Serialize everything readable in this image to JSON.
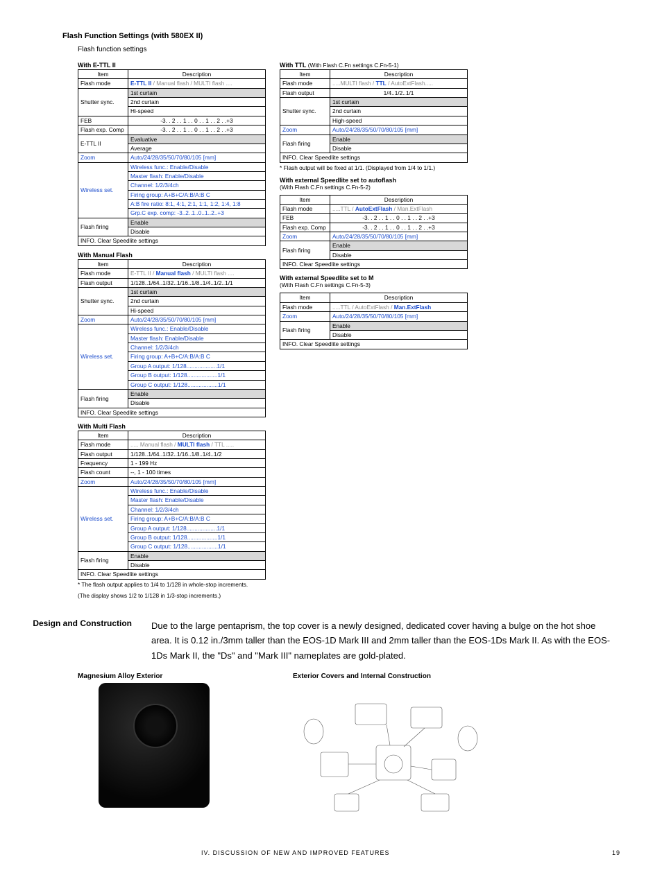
{
  "header": {
    "section_title": "Flash Function Settings (with 580EX II)",
    "subtitle": "Flash function settings"
  },
  "th_item": "Item",
  "th_desc": "Description",
  "info_clear": "INFO.    Clear Speedlite settings",
  "left": {
    "t1": {
      "caption": "With E-TTL II",
      "rows": [
        {
          "k": "Flash mode",
          "v": "E-TTL II / Manual flash / MULTI flash ....",
          "blue": true,
          "bold": "E-TTL II"
        },
        {
          "k": "Shutter sync.",
          "v1": "1st curtain",
          "v2": "2nd curtain",
          "v3": "Hi-speed",
          "grey": 1
        },
        {
          "k": "FEB",
          "v": "-3. . 2 . . 1 . . 0 . . 1 . . 2 . .+3",
          "center": true
        },
        {
          "k": "Flash exp. Comp",
          "v": "-3. . 2 . . 1 . . 0 . . 1 . . 2 . .+3",
          "center": true
        },
        {
          "k": "E-TTL II",
          "v1": "Evaluative",
          "v2": "Average",
          "grey": 1
        },
        {
          "k": "Zoom",
          "v": "Auto/24/28/35/50/70/80/105 [mm]",
          "blue": true,
          "kblue": true
        },
        {
          "k": "Wireless set.",
          "kblue": true,
          "list": [
            "Wireless func.: Enable/Disable",
            "Master flash: Enable/Disable",
            "Channel: 1/2/3/4ch",
            "Firing group: A+B+C/A:B/A:B C",
            "A:B fire ratio: 8:1, 4:1, 2:1, 1:1, 1:2, 1:4, 1:8",
            "Grp.C exp. comp: -3..2..1..0..1..2..+3"
          ]
        },
        {
          "k": "Flash firing",
          "v1": "Enable",
          "v2": "Disable",
          "grey": 1
        }
      ]
    },
    "t2": {
      "caption": "With Manual Flash",
      "rows": [
        {
          "k": "Flash mode",
          "v": "E-TTL II / Manual flash     / MULTI flash ....",
          "blue": true,
          "bold": "Manual flash"
        },
        {
          "k": "Flash output",
          "v": "1/128..1/64..1/32..1/16..1/8..1/4..1/2..1/1"
        },
        {
          "k": "Shutter sync.",
          "v1": "1st curtain",
          "v2": "2nd curtain",
          "v3": "Hi-speed",
          "grey": 1
        },
        {
          "k": "Zoom",
          "v": "Auto/24/28/35/50/70/80/105 [mm]",
          "blue": true,
          "kblue": true
        },
        {
          "k": "Wireless set.",
          "kblue": true,
          "list": [
            "Wireless func.: Enable/Disable",
            "Master flash: Enable/Disable",
            "Channel: 1/2/3/4ch",
            "Firing group: A+B+C/A:B/A:B C",
            "Group A output: 1/128...................1/1",
            "Group B output: 1/128...................1/1",
            "Group C output: 1/128...................1/1"
          ]
        },
        {
          "k": "Flash firing",
          "v1": "Enable",
          "v2": "Disable",
          "grey": 1
        }
      ]
    },
    "t3": {
      "caption": "With Multi Flash",
      "rows": [
        {
          "k": "Flash mode",
          "v": "..... Manual flash / MULTI flash      / TTL .....",
          "blue": true,
          "bold": "MULTI flash"
        },
        {
          "k": "Flash output",
          "v": "1/128..1/64..1/32..1/16..1/8..1/4..1/2"
        },
        {
          "k": "Frequency",
          "v": "1 - 199 Hz"
        },
        {
          "k": "Flash count",
          "v": "--, 1 - 100 times"
        },
        {
          "k": "Zoom",
          "v": "Auto/24/28/35/50/70/80/105 [mm]",
          "blue": true,
          "kblue": true
        },
        {
          "k": "Wireless set.",
          "kblue": true,
          "list": [
            "Wireless func.: Enable/Disable",
            "Master flash: Enable/Disable",
            "Channel: 1/2/3/4ch",
            "Firing group: A+B+C/A:B/A:B C",
            "Group A output: 1/128...................1/1",
            "Group B output: 1/128...................1/1",
            "Group C output: 1/128...................1/1"
          ]
        },
        {
          "k": "Flash firing",
          "v1": "Enable",
          "v2": "Disable",
          "grey": 1
        }
      ],
      "note1": "* The flash output applies to 1/4 to 1/128 in whole-stop increments.",
      "note2": "(The display shows 1/2 to 1/128 in 1/3-stop increments.)"
    }
  },
  "right": {
    "t1": {
      "caption": "With TTL ",
      "capsub": "(With Flash C.Fn settings C.Fn-5-1)",
      "rows": [
        {
          "k": "Flash mode",
          "v": ".....MULTI flash / TTL  / AutoExtFlash.....",
          "blue": true,
          "bold": "TTL"
        },
        {
          "k": "Flash output",
          "v": "1/4..1/2..1/1",
          "center": true
        },
        {
          "k": "Shutter sync.",
          "v1": "1st curtain",
          "v2": "2nd curtain",
          "v3": "High-speed",
          "grey": 1
        },
        {
          "k": "Zoom",
          "v": "Auto/24/28/35/50/70/80/105 [mm]",
          "blue": true,
          "kblue": true
        },
        {
          "k": "Flash firing",
          "v1": "Enable",
          "v2": "Disable",
          "grey": 1
        }
      ],
      "note": "* Flash output will be fixed at 1/1. (Displayed from 1/4 to 1/1.)"
    },
    "t2": {
      "caption": "With external Speedlite set to autoflash",
      "capsub": "(With Flash C.Fn settings C.Fn-5-2)",
      "rows": [
        {
          "k": "Flash mode",
          "v": ".....TTL / AutoExtFlash      / Man.ExtFlash",
          "blue": true,
          "bold": "AutoExtFlash"
        },
        {
          "k": "FEB",
          "v": "-3. . 2 . . 1 . . 0 . . 1 . . 2 . .+3",
          "center": true
        },
        {
          "k": "Flash exp. Comp",
          "v": "-3. . 2 . . 1 . . 0 . . 1 . . 2 . .+3",
          "center": true
        },
        {
          "k": "Zoom",
          "v": "Auto/24/28/35/50/70/80/105 [mm]",
          "blue": true,
          "kblue": true
        },
        {
          "k": "Flash firing",
          "v1": "Enable",
          "v2": "Disable",
          "grey": 1
        }
      ]
    },
    "t3": {
      "caption": "With external Speedlite set to M",
      "capsub": "(With Flash C.Fn settings C.Fn-5-3)",
      "rows": [
        {
          "k": "Flash mode",
          "v": ".....TTL / AutoExtFlash / Man.ExtFlash",
          "blue": true,
          "bold": "Man.ExtFlash"
        },
        {
          "k": "Zoom",
          "v": "Auto/24/28/35/50/70/80/105 [mm]",
          "blue": true,
          "kblue": true
        },
        {
          "k": "Flash firing",
          "v1": "Enable",
          "v2": "Disable",
          "grey": 1
        }
      ]
    }
  },
  "design": {
    "heading": "Design and Construction",
    "body": "Due to the large pentaprism, the top cover is a newly designed, dedicated cover having a bulge on the hot shoe area. It is 0.12 in./3mm taller than the EOS-1D Mark III and 2mm taller than the EOS-1Ds Mark II. As with the EOS-1Ds Mark II, the \"Ds\" and \"Mark III\" nameplates are gold-plated.",
    "img1": "Magnesium Alloy Exterior",
    "img2": "Exterior Covers and Internal Construction"
  },
  "footer": {
    "left": "IV. DISCUSSION OF NEW AND IMPROVED FEATURES",
    "right": "19"
  }
}
